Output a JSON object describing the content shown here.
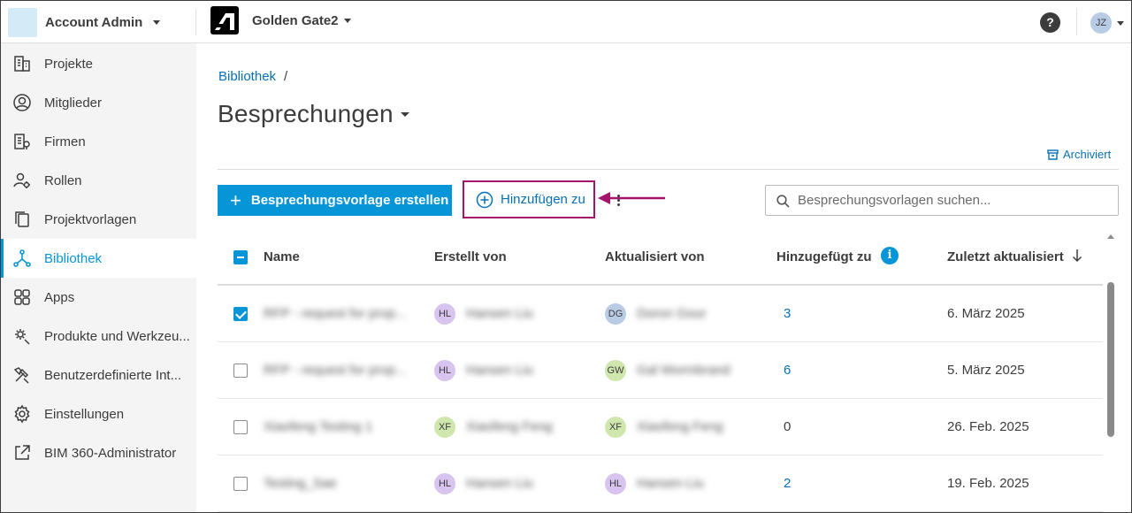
{
  "topbar": {
    "account_name": "Account Admin",
    "project_name": "Golden Gate2",
    "help_label": "?",
    "user_initials": "JZ"
  },
  "sidebar": {
    "items": [
      {
        "label": "Projekte",
        "icon": "building-icon",
        "active": false
      },
      {
        "label": "Mitglieder",
        "icon": "user-circle-icon",
        "active": false
      },
      {
        "label": "Firmen",
        "icon": "company-icon",
        "active": false
      },
      {
        "label": "Rollen",
        "icon": "user-gear-icon",
        "active": false
      },
      {
        "label": "Projektvorlagen",
        "icon": "copy-icon",
        "active": false
      },
      {
        "label": "Bibliothek",
        "icon": "library-icon",
        "active": true
      },
      {
        "label": "Apps",
        "icon": "apps-grid-icon",
        "active": false
      },
      {
        "label": "Produkte und Werkzeu...",
        "icon": "gear-wrench-icon",
        "active": false
      },
      {
        "label": "Benutzerdefinierte Int...",
        "icon": "tools-icon",
        "active": false
      },
      {
        "label": "Einstellungen",
        "icon": "gear-icon",
        "active": false
      },
      {
        "label": "BIM 360-Administrator",
        "icon": "external-link-icon",
        "active": false
      }
    ]
  },
  "breadcrumb": {
    "link": "Bibliothek",
    "separator": "/"
  },
  "page": {
    "title": "Besprechungen"
  },
  "toolbar": {
    "archived_label": "Archiviert",
    "create_label": "Besprechungsvorlage erstellen",
    "create_plus": "+",
    "add_label": "Hinzufügen zu",
    "search_placeholder": "Besprechungsvorlagen suchen..."
  },
  "table": {
    "headers": {
      "name": "Name",
      "created_by": "Erstellt von",
      "updated_by": "Aktualisiert von",
      "added_to": "Hinzugefügt zu",
      "last_updated": "Zuletzt aktualisiert"
    },
    "info_glyph": "i",
    "rows": [
      {
        "checked": true,
        "name": "RFP - request for prop...",
        "creator_initials": "HL",
        "creator": "Hansen Liu",
        "updater_initials": "DG",
        "updater": "Doron Gour",
        "added": "3",
        "date": "6. März 2025"
      },
      {
        "checked": false,
        "name": "RFP - request for prop...",
        "creator_initials": "HL",
        "creator": "Hansen Liu",
        "updater_initials": "GW",
        "updater": "Gal Wormbrand",
        "added": "6",
        "date": "5. März 2025"
      },
      {
        "checked": false,
        "name": "Xiaofeng Testing 1",
        "creator_initials": "XF",
        "creator": "Xiaofeng Feng",
        "updater_initials": "XF",
        "updater": "Xiaofeng Feng",
        "added": "0",
        "date": "26. Feb. 2025"
      },
      {
        "checked": false,
        "name": "Testing_Sae",
        "creator_initials": "HL",
        "creator": "Hansen Liu",
        "updater_initials": "HL",
        "updater": "Hansen Liu",
        "added": "2",
        "date": "19. Feb. 2025"
      }
    ]
  },
  "colors": {
    "accent": "#0696d7",
    "link": "#0670b6",
    "highlight_border": "#a3146b",
    "sidebar_bg": "#f4f4f4"
  }
}
